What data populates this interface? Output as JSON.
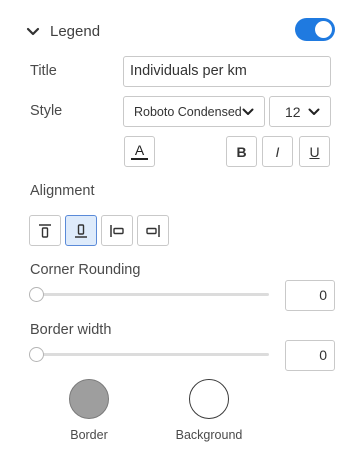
{
  "header": {
    "label": "Legend",
    "enabled": true
  },
  "title": {
    "label": "Title",
    "value": "Individuals per km"
  },
  "style": {
    "label": "Style",
    "font": "Roboto Condensed",
    "size": "12",
    "color_button_glyph": "A",
    "bold_label": "B",
    "italic_label": "I",
    "underline_label": "U"
  },
  "alignment": {
    "label": "Alignment",
    "options": [
      "top",
      "bottom",
      "left",
      "right"
    ],
    "selected": "bottom"
  },
  "corner_rounding": {
    "label": "Corner Rounding",
    "value": "0"
  },
  "border_width": {
    "label": "Border width",
    "value": "0"
  },
  "swatches": {
    "border": {
      "label": "Border",
      "color": "#9e9e9e"
    },
    "background": {
      "label": "Background",
      "color": "#ffffff"
    }
  },
  "colors": {
    "accent": "#1f7ae0",
    "active_bg": "#deebfb"
  }
}
